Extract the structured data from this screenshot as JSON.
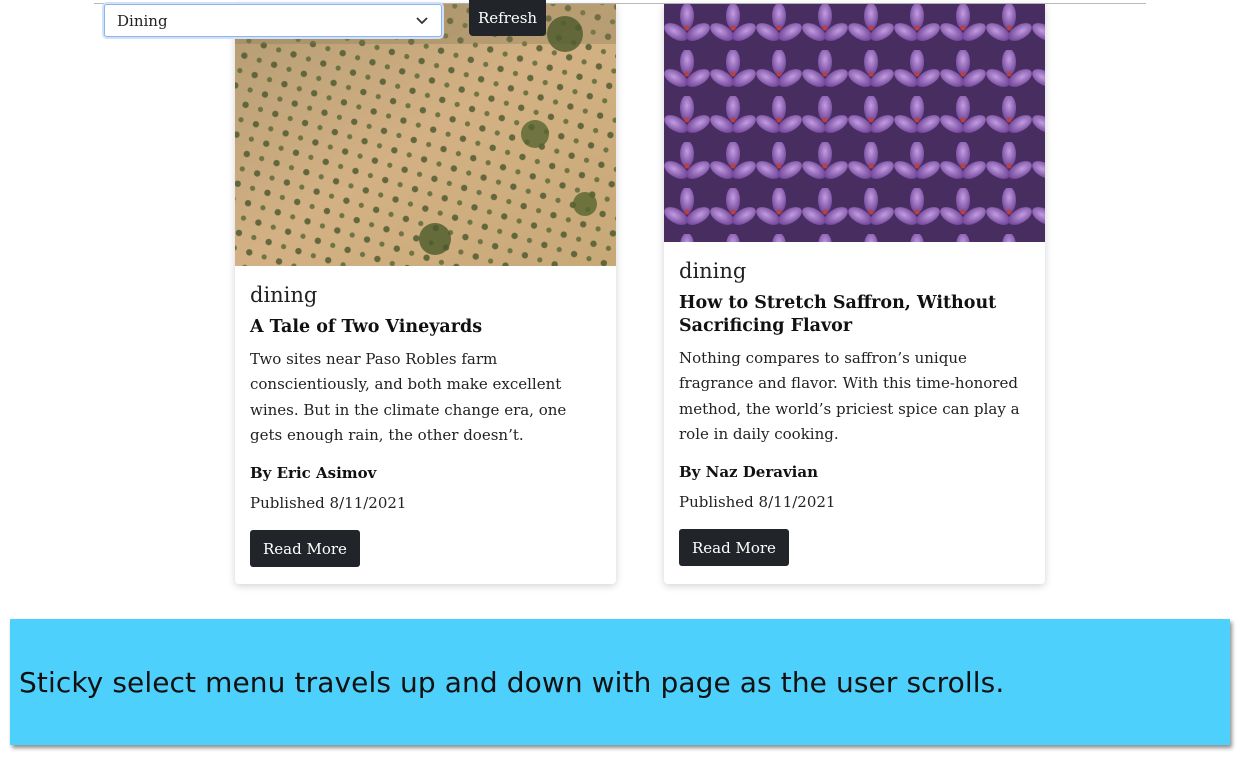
{
  "filter": {
    "selected": "Dining",
    "refresh_label": "Refresh"
  },
  "cards": [
    {
      "category": "dining",
      "title": "A Tale of Two Vineyards",
      "abstract": "Two sites near Paso Robles farm conscientiously, and both make excellent wines. But in the climate change era, one gets enough rain, the other doesn’t.",
      "byline": "By Eric Asimov",
      "published": "Published 8/11/2021",
      "button_label": "Read More",
      "image_desc": "vineyard-aerial-photo"
    },
    {
      "category": "dining",
      "title": "How to Stretch Saffron, Without Sacrificing Flavor",
      "abstract": "Nothing compares to saffron’s unique fragrance and flavor. With this time-honored method, the world’s priciest spice can play a role in daily cooking.",
      "byline": "By Naz Deravian",
      "published": "Published 8/11/2021",
      "button_label": "Read More",
      "image_desc": "saffron-crocus-photo"
    }
  ],
  "caption": {
    "text": "Sticky select menu travels up and down with page as the user scrolls."
  },
  "colors": {
    "dark_button": "#212529",
    "caption_bg": "#4dd0fc",
    "select_focus": "#8fb4e8"
  }
}
